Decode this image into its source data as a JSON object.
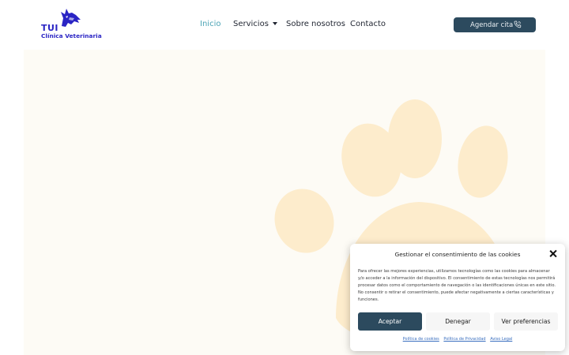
{
  "header": {
    "logo": {
      "brand": "TUI",
      "subtitle": "Clínica Veterinaria",
      "icon": "wolf-icon",
      "color": "#2a24c4"
    },
    "nav": [
      {
        "label": "Inicio",
        "active": true
      },
      {
        "label": "Servicios",
        "has_dropdown": true
      },
      {
        "label": "Sobre nosotros"
      },
      {
        "label": "Contacto"
      }
    ],
    "cta": {
      "label": "Agendar cita",
      "icon": "phone-icon"
    }
  },
  "hero": {
    "background": "#fdfbf5",
    "decoration": "paw-print",
    "paw_color": "#fdeccc"
  },
  "cookie_banner": {
    "title": "Gestionar el consentimiento de las cookies",
    "text": "Para ofrecer las mejores experiencias, utilizamos tecnologías como las cookies para almacenar y/o acceder a la información del dispositivo. El consentimiento de estas tecnologías nos permitirá procesar datos como el comportamiento de navegación o las identificaciones únicas en este sitio. No consentir o retirar el consentimiento, puede afectar negativamente a ciertas características y funciones.",
    "buttons": {
      "accept": "Aceptar",
      "deny": "Denegar",
      "preferences": "Ver preferencias"
    },
    "links": [
      "Política de cookies",
      "Política de Privacidad",
      "Aviso Legal"
    ]
  },
  "colors": {
    "accent": "#2c4a5e",
    "nav_active": "#4aa3b5",
    "link": "#3a6fbf"
  }
}
